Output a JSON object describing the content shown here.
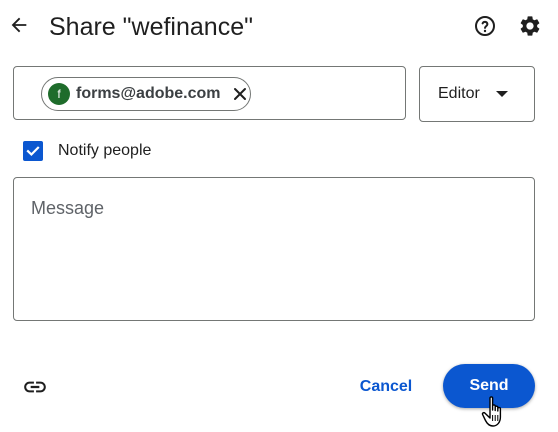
{
  "header": {
    "title": "Share \"wefinance\"",
    "back_icon": "arrow-back-icon",
    "help_icon": "help-icon",
    "settings_icon": "gear-icon"
  },
  "recipients": {
    "chips": [
      {
        "avatar_letter": "f",
        "email": "forms@adobe.com",
        "avatar_color": "#1e6c2b"
      }
    ]
  },
  "role": {
    "selected": "Editor"
  },
  "notify": {
    "label": "Notify people",
    "checked": true
  },
  "message": {
    "placeholder": "Message",
    "value": ""
  },
  "footer": {
    "link_icon": "link-icon",
    "cancel_label": "Cancel",
    "send_label": "Send"
  },
  "colors": {
    "accent": "#0b57d0",
    "border": "#747775",
    "avatar": "#1e6c2b"
  }
}
